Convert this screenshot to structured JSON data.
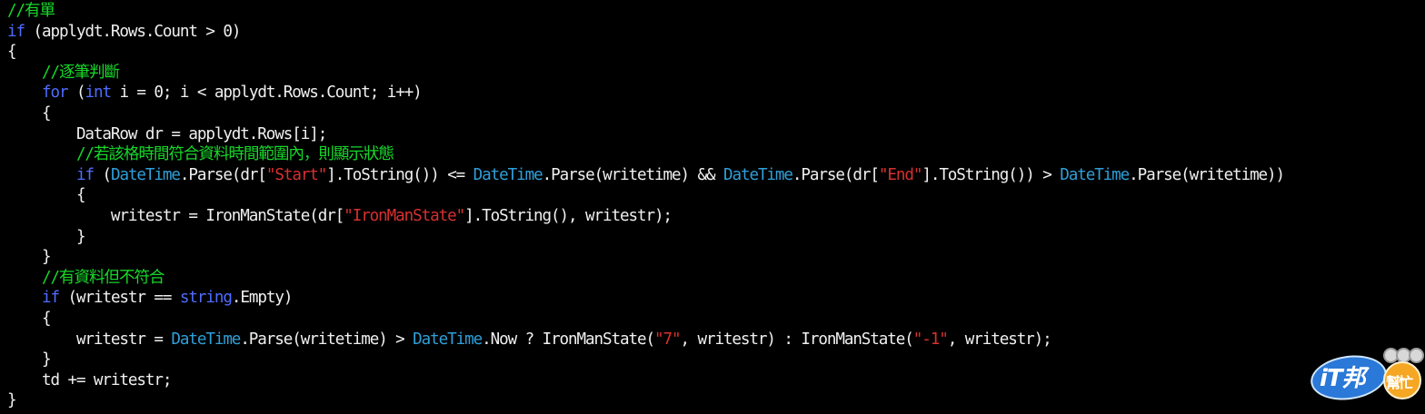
{
  "editor": {
    "lines": [
      {
        "tokens": [
          {
            "t": "//有單",
            "c": "comment"
          }
        ]
      },
      {
        "tokens": [
          {
            "t": "if",
            "c": "keyword"
          },
          {
            "t": " (applydt.Rows.Count > 0)",
            "c": "plain"
          }
        ]
      },
      {
        "tokens": [
          {
            "t": "{",
            "c": "plain"
          }
        ]
      },
      {
        "tokens": [
          {
            "t": "    ",
            "c": "plain"
          },
          {
            "t": "//逐筆判斷",
            "c": "comment"
          }
        ]
      },
      {
        "tokens": [
          {
            "t": "    ",
            "c": "plain"
          },
          {
            "t": "for",
            "c": "keyword"
          },
          {
            "t": " (",
            "c": "plain"
          },
          {
            "t": "int",
            "c": "keyword"
          },
          {
            "t": " i = 0; i < applydt.Rows.Count; i++)",
            "c": "plain"
          }
        ]
      },
      {
        "tokens": [
          {
            "t": "    {",
            "c": "plain"
          }
        ]
      },
      {
        "tokens": [
          {
            "t": "        DataRow dr = applydt.Rows[i];",
            "c": "plain"
          }
        ]
      },
      {
        "tokens": [
          {
            "t": "        ",
            "c": "plain"
          },
          {
            "t": "//若該格時間符合資料時間範圍內，則顯示狀態",
            "c": "comment"
          }
        ]
      },
      {
        "tokens": [
          {
            "t": "        ",
            "c": "plain"
          },
          {
            "t": "if",
            "c": "keyword"
          },
          {
            "t": " (",
            "c": "plain"
          },
          {
            "t": "DateTime",
            "c": "type"
          },
          {
            "t": ".Parse(dr[",
            "c": "plain"
          },
          {
            "t": "\"Start\"",
            "c": "string"
          },
          {
            "t": "].ToString()) <= ",
            "c": "plain"
          },
          {
            "t": "DateTime",
            "c": "type"
          },
          {
            "t": ".Parse(writetime) && ",
            "c": "plain"
          },
          {
            "t": "DateTime",
            "c": "type"
          },
          {
            "t": ".Parse(dr[",
            "c": "plain"
          },
          {
            "t": "\"End\"",
            "c": "string"
          },
          {
            "t": "].ToString()) > ",
            "c": "plain"
          },
          {
            "t": "DateTime",
            "c": "type"
          },
          {
            "t": ".Parse(writetime))",
            "c": "plain"
          }
        ]
      },
      {
        "tokens": [
          {
            "t": "        {",
            "c": "plain"
          }
        ]
      },
      {
        "tokens": [
          {
            "t": "            writestr = IronManState(dr[",
            "c": "plain"
          },
          {
            "t": "\"IronManState\"",
            "c": "string"
          },
          {
            "t": "].ToString(), writestr);",
            "c": "plain"
          }
        ]
      },
      {
        "tokens": [
          {
            "t": "        }",
            "c": "plain"
          }
        ]
      },
      {
        "tokens": [
          {
            "t": "    }",
            "c": "plain"
          }
        ]
      },
      {
        "tokens": [
          {
            "t": "    ",
            "c": "plain"
          },
          {
            "t": "//有資料但不符合",
            "c": "comment"
          }
        ]
      },
      {
        "tokens": [
          {
            "t": "    ",
            "c": "plain"
          },
          {
            "t": "if",
            "c": "keyword"
          },
          {
            "t": " (writestr == ",
            "c": "plain"
          },
          {
            "t": "string",
            "c": "keyword"
          },
          {
            "t": ".Empty)",
            "c": "plain"
          }
        ]
      },
      {
        "tokens": [
          {
            "t": "    {",
            "c": "plain"
          }
        ]
      },
      {
        "tokens": [
          {
            "t": "        writestr = ",
            "c": "plain"
          },
          {
            "t": "DateTime",
            "c": "type"
          },
          {
            "t": ".Parse(writetime) > ",
            "c": "plain"
          },
          {
            "t": "DateTime",
            "c": "type"
          },
          {
            "t": ".Now ? IronManState(",
            "c": "plain"
          },
          {
            "t": "\"7\"",
            "c": "string"
          },
          {
            "t": ", writestr) : IronManState(",
            "c": "plain"
          },
          {
            "t": "\"-1\"",
            "c": "string"
          },
          {
            "t": ", writestr);",
            "c": "plain"
          }
        ]
      },
      {
        "tokens": [
          {
            "t": "    }",
            "c": "plain"
          }
        ]
      },
      {
        "tokens": [
          {
            "t": "    td += writestr;",
            "c": "plain"
          }
        ]
      },
      {
        "tokens": [
          {
            "t": "}",
            "c": "plain"
          }
        ]
      }
    ]
  },
  "colors": {
    "background": "#000000",
    "plain": "#f0f0f0",
    "keyword": "#4f6cff",
    "type": "#2f9fd8",
    "comment": "#17d82a",
    "string": "#d83030"
  },
  "watermark": {
    "main_text": "iT邦",
    "sub_text": "幫忙"
  }
}
